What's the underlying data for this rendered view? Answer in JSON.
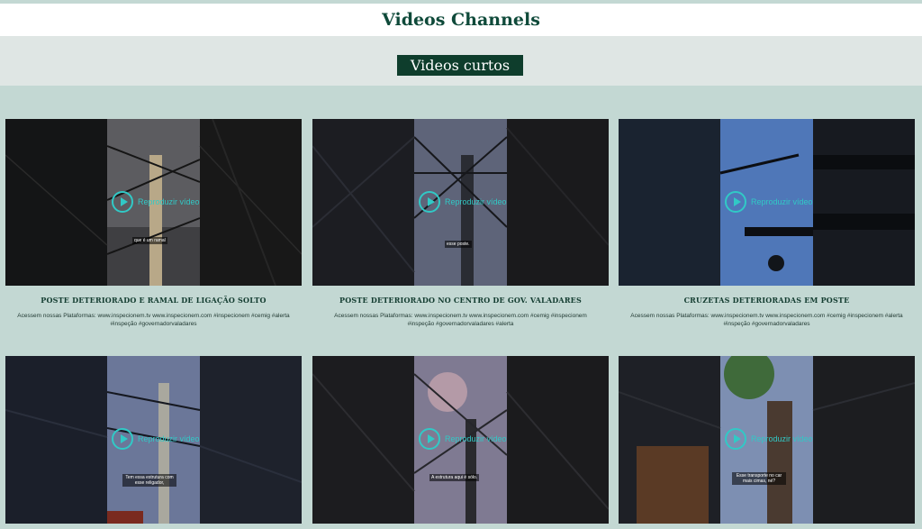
{
  "header": {
    "title": "Videos Channels"
  },
  "section": {
    "label": "Videos curtos"
  },
  "play_label": "Reproduzir vídeo",
  "videos": [
    {
      "title": "POSTE DETERIORADO E RAMAL DE LIGAÇÃO SOLTO",
      "description": "Acessem nossas Plataformas: www.inspecionem.tv www.inspecionem.com #inspecionem #cemig #alerta #inspeção #governadorvaladares",
      "caption": "que é um ramal"
    },
    {
      "title": "POSTE DETERIORADO NO CENTRO DE GOV. VALADARES",
      "description": "Acessem nossas Plataformas: www.inspecionem.tv www.inspecionem.com #cemig #inspecionem #inspeção #governadorvaladares #alerta",
      "caption": "esse poste."
    },
    {
      "title": "CRUZETAS DETERIORADAS EM POSTE",
      "description": "Acessem nossas Plataformas: www.inspecionem.tv www.inspecionem.com #cemig #inspecionem #alerta #inspeção #governadorvaladares",
      "caption": ""
    },
    {
      "title": "",
      "description": "",
      "caption": "Tem essa estrutura com esse religador,"
    },
    {
      "title": "",
      "description": "",
      "caption": "A estrutura aqui é sólo."
    },
    {
      "title": "",
      "description": "",
      "caption": "Esse transporte no car mais cimas, né?"
    }
  ],
  "colors": {
    "header_text": "#0f4a3a",
    "pill_bg": "#0e3d2c",
    "page_bg": "#c3d8d3",
    "play_accent": "#31c9c6"
  }
}
